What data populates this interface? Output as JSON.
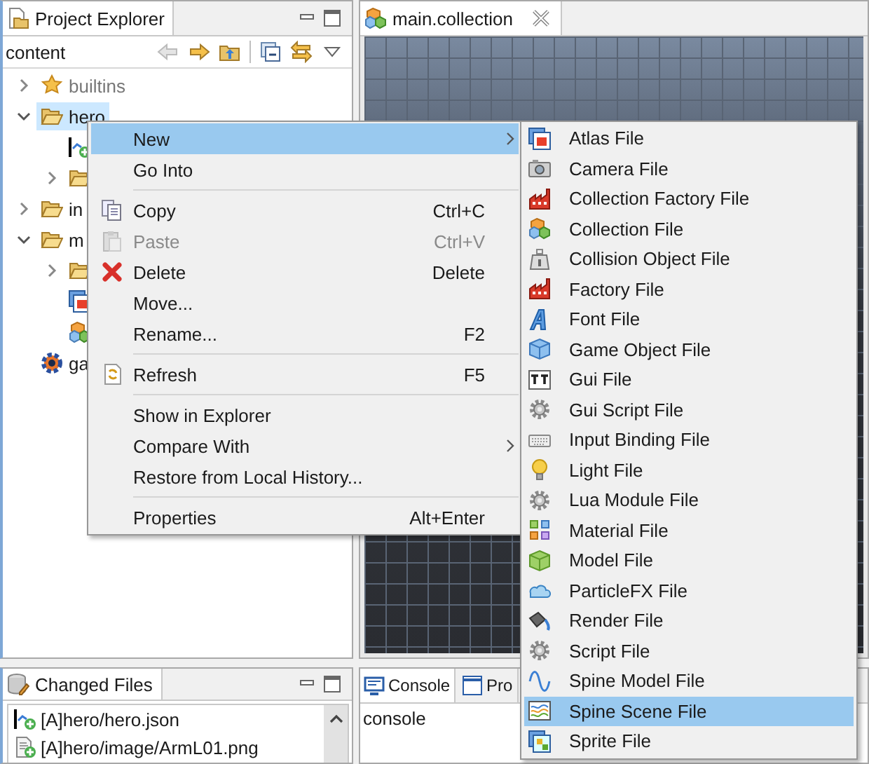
{
  "explorer": {
    "tab": "Project Explorer",
    "path": "content",
    "toolbar": [
      {
        "disabled": true
      },
      {
        "disabled": false
      },
      {
        "disabled": false
      },
      {
        "disabled": false
      },
      {
        "disabled": false
      },
      {
        "disabled": false
      }
    ],
    "tree": [
      {
        "label": "builtins",
        "kind": "library",
        "expanded": false,
        "selected": false
      },
      {
        "label": "hero",
        "kind": "folder",
        "expanded": true,
        "selected": true,
        "children": [
          {
            "kind": "json",
            "selected": false
          },
          {
            "kind": "folder",
            "expanded": false,
            "selected": false
          }
        ]
      },
      {
        "label": "in",
        "kind": "folder",
        "expanded": false,
        "selected": false
      },
      {
        "label": "m",
        "kind": "folder",
        "expanded": true,
        "selected": false,
        "children": [
          {
            "kind": "folder",
            "expanded": false,
            "selected": false
          },
          {
            "kind": "atlas",
            "selected": false
          },
          {
            "kind": "collection",
            "selected": false
          }
        ]
      },
      {
        "label": "ga",
        "kind": "project",
        "selected": false
      }
    ]
  },
  "editor": {
    "tab": "main.collection"
  },
  "changed_files": {
    "tab": "Changed Files",
    "items": [
      {
        "label": "[A]hero/hero.json",
        "kind": "json"
      },
      {
        "label": "[A]hero/image/ArmL01.png",
        "kind": "file"
      }
    ]
  },
  "console": {
    "tabs": [
      {
        "label": "Console",
        "selected": true
      },
      {
        "label": "Pro",
        "selected": false
      }
    ],
    "text": "console"
  },
  "context_menu": {
    "items": [
      {
        "kind": "item",
        "label": "New",
        "submenu": true,
        "selected": true,
        "disabled": false
      },
      {
        "kind": "item",
        "label": "Go Into",
        "selected": false,
        "disabled": false
      },
      {
        "kind": "separator"
      },
      {
        "kind": "item",
        "label": "Copy",
        "shortcut": "Ctrl+C",
        "selected": false,
        "disabled": false
      },
      {
        "kind": "item",
        "label": "Paste",
        "shortcut": "Ctrl+V",
        "selected": false,
        "disabled": true
      },
      {
        "kind": "item",
        "label": "Delete",
        "shortcut": "Delete",
        "selected": false,
        "disabled": false
      },
      {
        "kind": "item",
        "label": "Move...",
        "selected": false,
        "disabled": false
      },
      {
        "kind": "item",
        "label": "Rename...",
        "shortcut": "F2",
        "selected": false,
        "disabled": false
      },
      {
        "kind": "separator"
      },
      {
        "kind": "item",
        "label": "Refresh",
        "shortcut": "F5",
        "selected": false,
        "disabled": false
      },
      {
        "kind": "separator"
      },
      {
        "kind": "item",
        "label": "Show in Explorer",
        "selected": false,
        "disabled": false
      },
      {
        "kind": "item",
        "label": "Compare With",
        "submenu": true,
        "selected": false,
        "disabled": false
      },
      {
        "kind": "item",
        "label": "Restore from Local History...",
        "selected": false,
        "disabled": false
      },
      {
        "kind": "separator"
      },
      {
        "kind": "item",
        "label": "Properties",
        "shortcut": "Alt+Enter",
        "selected": false,
        "disabled": false
      }
    ]
  },
  "new_submenu": {
    "items": [
      {
        "label": "Atlas File",
        "selected": false
      },
      {
        "label": "Camera File",
        "selected": false
      },
      {
        "label": "Collection Factory File",
        "selected": false
      },
      {
        "label": "Collection File",
        "selected": false
      },
      {
        "label": "Collision Object File",
        "selected": false
      },
      {
        "label": "Factory File",
        "selected": false
      },
      {
        "label": "Font File",
        "selected": false
      },
      {
        "label": "Game Object File",
        "selected": false
      },
      {
        "label": "Gui File",
        "selected": false
      },
      {
        "label": "Gui Script File",
        "selected": false
      },
      {
        "label": "Input Binding File",
        "selected": false
      },
      {
        "label": "Light File",
        "selected": false
      },
      {
        "label": "Lua Module File",
        "selected": false
      },
      {
        "label": "Material File",
        "selected": false
      },
      {
        "label": "Model File",
        "selected": false
      },
      {
        "label": "ParticleFX File",
        "selected": false
      },
      {
        "label": "Render File",
        "selected": false
      },
      {
        "label": "Script File",
        "selected": false
      },
      {
        "label": "Spine Model File",
        "selected": false
      },
      {
        "label": "Spine Scene File",
        "selected": true
      },
      {
        "label": "Sprite File",
        "selected": false
      }
    ]
  }
}
